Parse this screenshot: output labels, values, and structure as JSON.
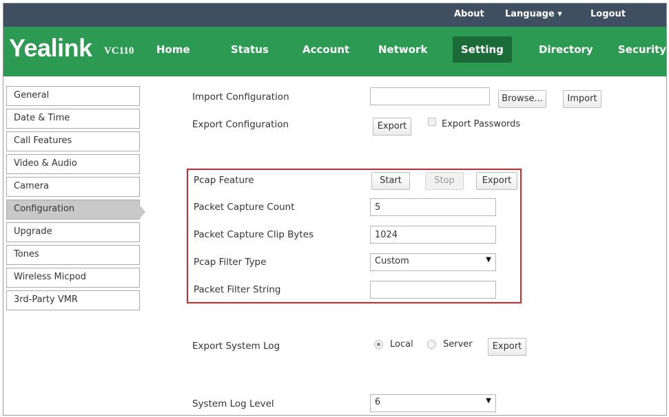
{
  "topbar": {
    "about": "About",
    "language": "Language ▾",
    "logout": "Logout"
  },
  "brand": {
    "logo": "Yealink",
    "model": "VC110"
  },
  "nav": {
    "tabs": [
      "Home",
      "Status",
      "Account",
      "Network",
      "Setting",
      "Directory",
      "Security"
    ],
    "active": "Setting"
  },
  "sidebar": {
    "items": [
      "General",
      "Date & Time",
      "Call Features",
      "Video & Audio",
      "Camera",
      "Configuration",
      "Upgrade",
      "Tones",
      "Wireless Micpod",
      "3rd-Party VMR"
    ],
    "active": "Configuration"
  },
  "config": {
    "import_label": "Import Configuration",
    "import_value": "",
    "browse": "Browse...",
    "import_btn": "Import",
    "export_label": "Export Configuration",
    "export_btn": "Export",
    "export_passwords": "Export Passwords",
    "export_passwords_checked": false
  },
  "pcap": {
    "feature_label": "Pcap Feature",
    "start": "Start",
    "stop": "Stop",
    "export": "Export",
    "count_label": "Packet Capture Count",
    "count_value": "5",
    "clip_label": "Packet Capture Clip Bytes",
    "clip_value": "1024",
    "filter_type_label": "Pcap Filter Type",
    "filter_type_value": "Custom",
    "filter_string_label": "Packet Filter String",
    "filter_string_value": ""
  },
  "syslog": {
    "export_label": "Export System Log",
    "local": "Local",
    "server": "Server",
    "selected": "Local",
    "export_btn": "Export",
    "level_label": "System Log Level",
    "level_value": "6"
  },
  "colors": {
    "topbar": "#3f4f5f",
    "navbar": "#2c9a52",
    "active_tab": "#1b6a38",
    "highlight_border": "#d4262c"
  },
  "icons": {
    "dropdown": "triangle-down-icon"
  }
}
